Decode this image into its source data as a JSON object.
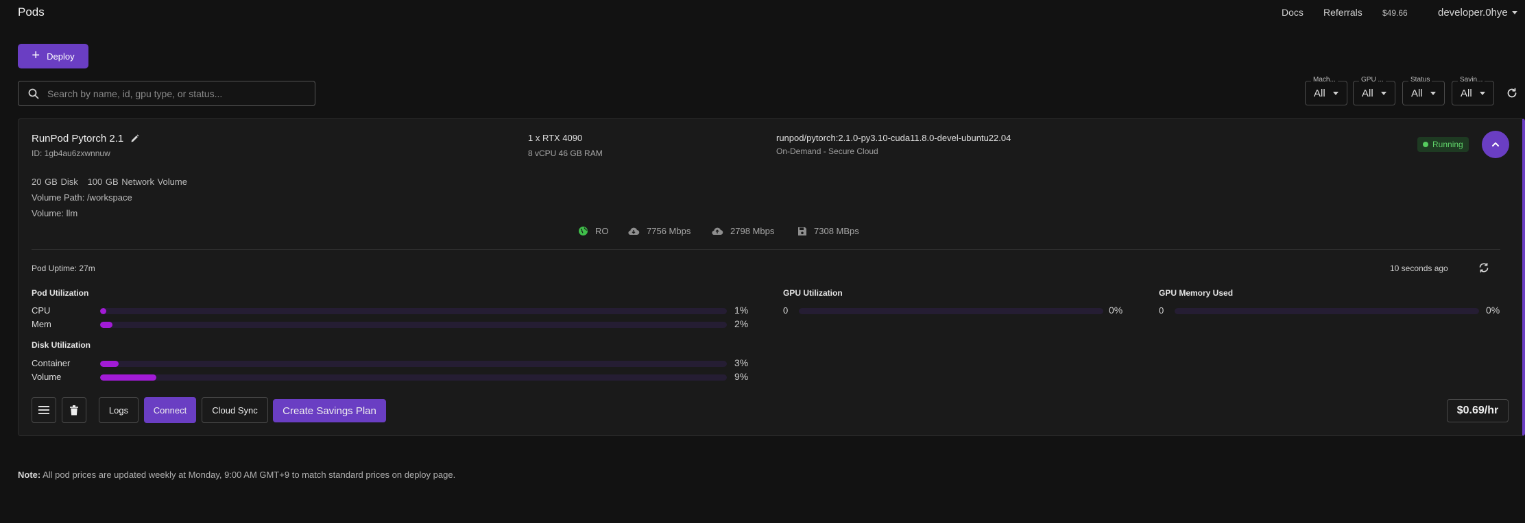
{
  "header": {
    "title": "Pods",
    "docs": "Docs",
    "referrals": "Referrals",
    "balance": "$49.66",
    "user": "developer.0hye"
  },
  "deploy_label": "Deploy",
  "search": {
    "placeholder": "Search by name, id, gpu type, or status..."
  },
  "filters": [
    {
      "label": "Mach...",
      "value": "All"
    },
    {
      "label": "GPU ...",
      "value": "All"
    },
    {
      "label": "Status",
      "value": "All"
    },
    {
      "label": "Savin...",
      "value": "All"
    }
  ],
  "pod": {
    "name": "RunPod Pytorch 2.1",
    "id": "ID: 1gb4au6zxwnnuw",
    "gpu": "1 x RTX 4090",
    "cpu_ram": "8 vCPU 46 GB RAM",
    "image": "runpod/pytorch:2.1.0-py3.10-cuda11.8.0-devel-ubuntu22.04",
    "cloud": "On-Demand - Secure Cloud",
    "status": "Running",
    "disk": "20 GB Disk   100 GB Network Volume",
    "volume_path": "Volume Path: /workspace",
    "volume": "Volume: llm",
    "network": {
      "region": "RO",
      "download": "7756 Mbps",
      "upload": "2798 Mbps",
      "disk_speed": "7308 MBps"
    },
    "uptime": "Pod Uptime: 27m",
    "updated": "10 seconds ago",
    "pod_util_title": "Pod Utilization",
    "disk_util_title": "Disk Utilization",
    "gpu_util_title": "GPU Utilization",
    "gpu_mem_title": "GPU Memory Used",
    "cpu": {
      "label": "CPU",
      "pct": "1%",
      "value": 1
    },
    "mem": {
      "label": "Mem",
      "pct": "2%",
      "value": 2
    },
    "container": {
      "label": "Container",
      "pct": "3%",
      "value": 3
    },
    "volume_disk": {
      "label": "Volume",
      "pct": "9%",
      "value": 9
    },
    "gpu_util": {
      "label": "0",
      "pct": "0%",
      "value": 0
    },
    "gpu_mem": {
      "label": "0",
      "pct": "0%",
      "value": 0
    },
    "actions": {
      "logs": "Logs",
      "connect": "Connect",
      "cloud_sync": "Cloud Sync",
      "savings": "Create Savings Plan"
    },
    "price": "$0.69/hr"
  },
  "note": {
    "prefix": "Note:",
    "text": " All pod prices are updated weekly at Monday, 9:00 AM GMT+9 to match standard prices on deploy page."
  },
  "colors": {
    "accent": "#6a3ec3",
    "bar": "#a21bd6",
    "running": "#55cc5e"
  }
}
